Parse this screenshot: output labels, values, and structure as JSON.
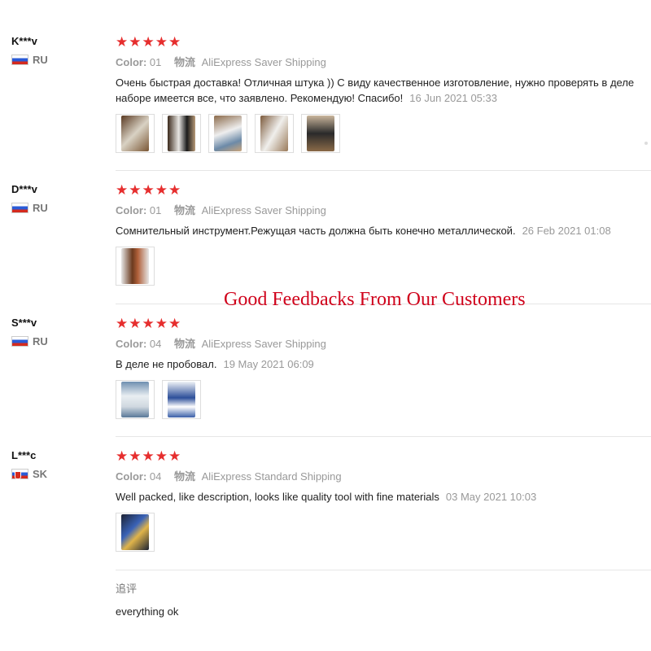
{
  "banner": "Good Feedbacks From Our Customers",
  "labels": {
    "color": "Color:",
    "shipping": "物流",
    "followup": "追评"
  },
  "star_glyph": "★",
  "colors": {
    "star": "#e62e2e",
    "banner": "#d0021b",
    "meta": "#999999"
  },
  "reviews": [
    {
      "user": "K***v",
      "country": "RU",
      "rating": 5,
      "color_value": "01",
      "shipping": "AliExpress Saver Shipping",
      "text_line1": "Очень быстрая доставка! Отличная штука )) С виду качественное изготовление, нужно проверять в деле",
      "text_line2": "наборе имеется все, что заявлено. Рекомендую! Спасибо!",
      "date": "16 Jun 2021 05:33",
      "photos": 5
    },
    {
      "user": "D***v",
      "country": "RU",
      "rating": 5,
      "color_value": "01",
      "shipping": "AliExpress Saver Shipping",
      "text": "Сомнительный инструмент.Режущая часть должна быть конечно металлической.",
      "date": "26 Feb 2021 01:08",
      "photos": 1
    },
    {
      "user": "S***v",
      "country": "RU",
      "rating": 5,
      "color_value": "04",
      "shipping": "AliExpress Saver Shipping",
      "text": "В деле не пробовал.",
      "date": "19 May 2021 06:09",
      "photos": 2
    },
    {
      "user": "L***c",
      "country": "SK",
      "rating": 5,
      "color_value": "04",
      "shipping": "AliExpress Standard Shipping",
      "text": "Well packed, like description, looks like quality tool with fine materials",
      "date": "03 May 2021 10:03",
      "photos": 1,
      "followup_text": "everything ok"
    }
  ]
}
